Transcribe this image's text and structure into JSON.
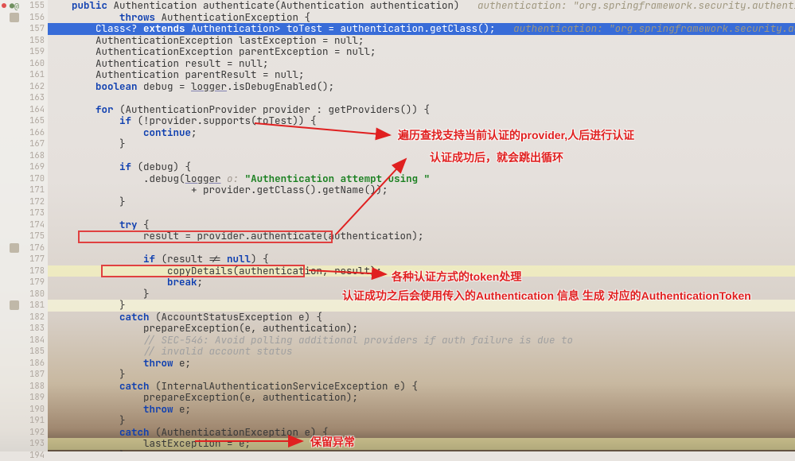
{
  "gutter": {
    "start": 155,
    "end": 194,
    "breakpoint_at": 155,
    "overridden_at": 155,
    "markers_at": [
      156,
      176,
      181
    ]
  },
  "code": {
    "l155": {
      "indent": "    ",
      "pre_kw": "public",
      "mid": " Authentication authenticate(Authentication authentication)",
      "inlay": "   authentication: \"org.springframework.security.authentication.UsernamePass"
    },
    "l156": {
      "indent": "            ",
      "kw": "throws",
      "rest": " AuthenticationException {"
    },
    "l157": {
      "indent": "        ",
      "text": "Class<? ",
      "kw": "extends",
      "rest": " Authentication> toTest = authentication.getClass();",
      "inlay": "   authentication: \"org.springframework.security.authentication.Username"
    },
    "l158": "        AuthenticationException lastException = null;",
    "l159": "        AuthenticationException parentException = null;",
    "l160": "        Authentication result = null;",
    "l161": "        Authentication parentResult = null;",
    "l162": {
      "indent": "        ",
      "kw": "boolean",
      "rest": " debug = ",
      "field": "logger",
      "tail": ".isDebugEnabled();"
    },
    "l163": "",
    "l164": {
      "indent": "        ",
      "kw": "for",
      "rest": " (AuthenticationProvider provider : getProviders()) {"
    },
    "l165": {
      "indent": "            ",
      "kw": "if",
      "rest": " (!provider.supports(toTest)) {"
    },
    "l166": {
      "indent": "                ",
      "kw": "continue",
      "tail": ";"
    },
    "l167": "            }",
    "l168": "",
    "l169": {
      "indent": "            ",
      "kw": "if",
      "rest": " (debug) {"
    },
    "l170": {
      "indent": "                ",
      "field": "logger",
      "mid": ".debug(",
      "hint": " o: ",
      "str": "\"Authentication attempt using \"",
      "tail": ""
    },
    "l171": "                        + provider.getClass().getName());",
    "l172": "            }",
    "l173": "",
    "l174": {
      "indent": "            ",
      "kw": "try",
      "rest": " {"
    },
    "l175": "                result = provider.authenticate(authentication);",
    "l176": "",
    "l177": {
      "indent": "                ",
      "kw": "if",
      "rest": " (result != ",
      "kw2": "null",
      "tail": ") {"
    },
    "l178": "                    copyDetails(authentication, result);",
    "l179": {
      "indent": "                    ",
      "kw": "break",
      "tail": ";"
    },
    "l180": "                }",
    "l181": "            }",
    "l182": {
      "indent": "            ",
      "kw": "catch",
      "rest": " (AccountStatusException e) {"
    },
    "l183": "                prepareException(e, authentication);",
    "l184": {
      "cmt": "                // SEC-546: Avoid polling additional providers if auth failure is due to"
    },
    "l185": {
      "cmt": "                // invalid account status"
    },
    "l186": {
      "indent": "                ",
      "kw": "throw",
      "rest": " e;"
    },
    "l187": "            }",
    "l188": {
      "indent": "            ",
      "kw": "catch",
      "rest": " (InternalAuthenticationServiceException e) {"
    },
    "l189": "                prepareException(e, authentication);",
    "l190": {
      "indent": "                ",
      "kw": "throw",
      "rest": " e;"
    },
    "l191": "            }",
    "l192": {
      "indent": "            ",
      "kw": "catch",
      "rest": " (AuthenticationException e) {"
    },
    "l193": "                lastException = e;",
    "l194": "            }"
  },
  "annotations": {
    "a1": "遍历查找支持当前认证的provider,人后进行认证",
    "a2": "认证成功后，就会跳出循环",
    "a3": "各种认证方式的token处理",
    "a4": "认证成功之后会使用传入的Authentication 信息 生成 对应的AuthenticationToken",
    "a5": "保留异常"
  }
}
